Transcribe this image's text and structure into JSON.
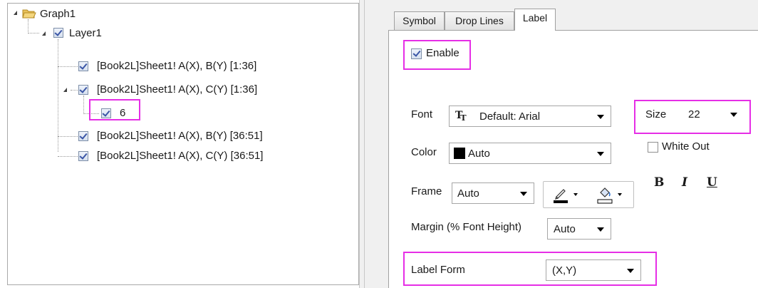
{
  "tree": {
    "root": {
      "label": "Graph1"
    },
    "layer": {
      "label": "Layer1"
    },
    "items": [
      {
        "label": "[Book2L]Sheet1! A(X), B(Y) [1:36]"
      },
      {
        "label": "[Book2L]Sheet1! A(X), C(Y) [1:36]"
      },
      {
        "label": "6"
      },
      {
        "label": "[Book2L]Sheet1! A(X), B(Y) [36:51]"
      },
      {
        "label": "[Book2L]Sheet1! A(X), C(Y) [36:51]"
      }
    ]
  },
  "tabs": [
    "Symbol",
    "Drop Lines",
    "Label"
  ],
  "active_tab": "Label",
  "label_tab": {
    "enable_label": "Enable",
    "enable_checked": true,
    "font_label": "Font",
    "font_icon": "truetype-icon",
    "font_value": "Default: Arial",
    "size_label": "Size",
    "size_value": "22",
    "color_label": "Color",
    "color_value": "Auto",
    "color_swatch": "#000000",
    "white_out_label": "White Out",
    "white_out_checked": false,
    "bold": "B",
    "italic": "I",
    "underline": "U",
    "frame_label": "Frame",
    "frame_value": "Auto",
    "margin_label": "Margin (% Font Height)",
    "margin_value": "Auto",
    "label_form_label": "Label Form",
    "label_form_value": "(X,Y)"
  },
  "colors": {
    "highlight": "#e62ee6",
    "checkmark": "#3b56a6"
  }
}
